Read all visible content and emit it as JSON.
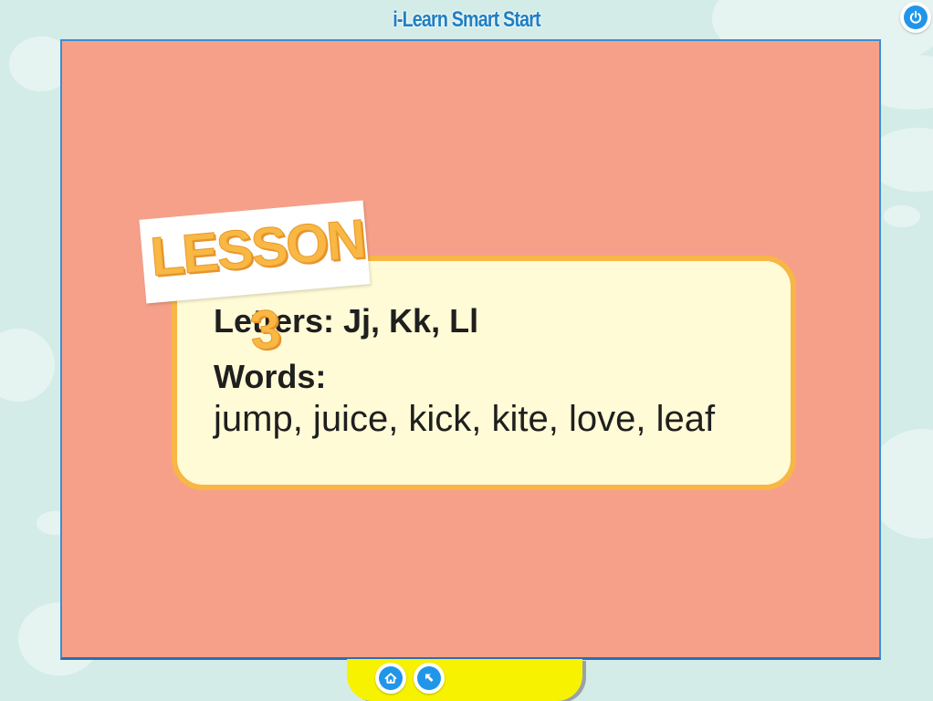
{
  "app": {
    "title": "i-Learn Smart Start"
  },
  "toolbar": {
    "power_icon": "power-icon",
    "home_icon": "home-icon",
    "back_icon": "back-arrow-icon"
  },
  "slide": {
    "badge": "LESSON 3",
    "letters_line": "Letters: Jj, Kk, Ll",
    "words_heading": "Words:",
    "words_list": "jump, juice, kick, kite, love, leaf"
  },
  "colors": {
    "background": "#d4ece8",
    "slide_background": "#f6a08a",
    "card_background": "#fffbd6",
    "card_border": "#f7b646",
    "badge_text": "#f9b744",
    "title": "#1f7fc4",
    "button_blue": "#2196e8",
    "bottom_bar": "#f7f300"
  }
}
